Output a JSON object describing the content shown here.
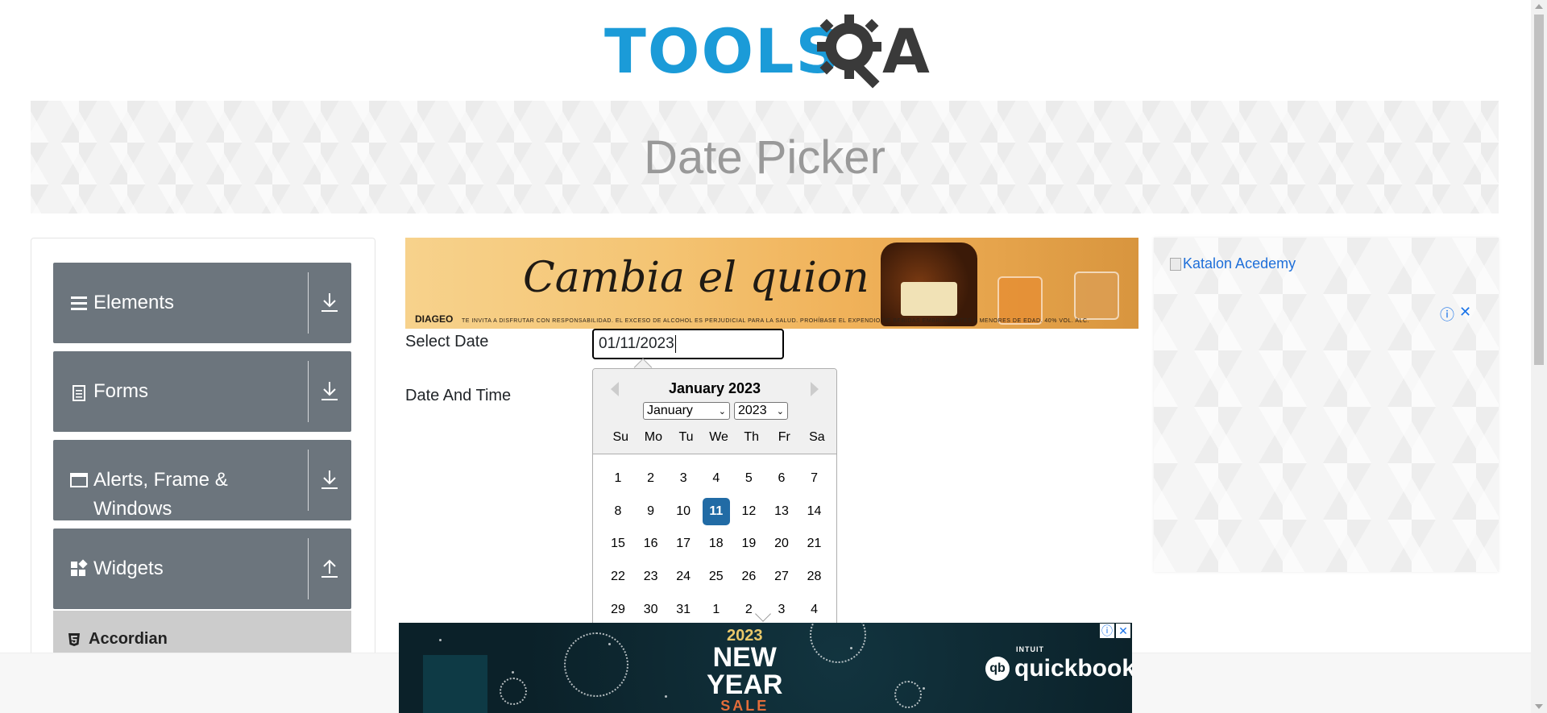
{
  "header": {
    "logo_left": "TOOLS",
    "logo_right": "A",
    "logo_icon": "gear-search-icon"
  },
  "banner": {
    "title": "Date Picker"
  },
  "sidebar": {
    "groups": [
      {
        "label": "Elements",
        "icon": "hamburger-icon",
        "arrow": "download-icon"
      },
      {
        "label": "Forms",
        "icon": "document-icon",
        "arrow": "download-icon"
      },
      {
        "label": "Alerts, Frame & Windows",
        "icon": "window-icon",
        "arrow": "download-icon"
      },
      {
        "label": "Widgets",
        "icon": "widgets-icon",
        "arrow": "upload-icon"
      }
    ],
    "active_item": "Accordian"
  },
  "ad_top": {
    "headline": "Cambia el quion",
    "brand": "DIAGEO",
    "disclaimer": "TE INVITA A DISFRUTAR CON RESPONSABILIDAD. EL EXCESO DE ALCOHOL ES PERJUDICIAL PARA LA SALUD. PROHÍBASE EL EXPENDIO DE BEBIDAS EMBRIAGANTES A MENORES DE EDAD. 40% VOL. ALC."
  },
  "form": {
    "select_date_label": "Select Date",
    "date_value": "01/11/2023",
    "date_time_label": "Date And Time"
  },
  "datepicker": {
    "title": "January 2023",
    "month_select": "January",
    "year_select": "2023",
    "weekdays": [
      "Su",
      "Mo",
      "Tu",
      "We",
      "Th",
      "Fr",
      "Sa"
    ],
    "weeks": [
      [
        "1",
        "2",
        "3",
        "4",
        "5",
        "6",
        "7"
      ],
      [
        "8",
        "9",
        "10",
        "11",
        "12",
        "13",
        "14"
      ],
      [
        "15",
        "16",
        "17",
        "18",
        "19",
        "20",
        "21"
      ],
      [
        "22",
        "23",
        "24",
        "25",
        "26",
        "27",
        "28"
      ],
      [
        "29",
        "30",
        "31",
        "1",
        "2",
        "3",
        "4"
      ]
    ],
    "selected_day": "11"
  },
  "ad_right": {
    "image_alt": "Katalon Acedemy",
    "info_icon": "ⓘ",
    "close_icon": "✕"
  },
  "ad_bottom": {
    "year": "2023",
    "line1": "NEW",
    "line2": "YEAR",
    "line3": "SALE",
    "brand_top": "INTUIT",
    "brand": "quickbooks",
    "brand_icon": "qb",
    "info_icon": "ⓘ",
    "close_icon": "✕"
  }
}
